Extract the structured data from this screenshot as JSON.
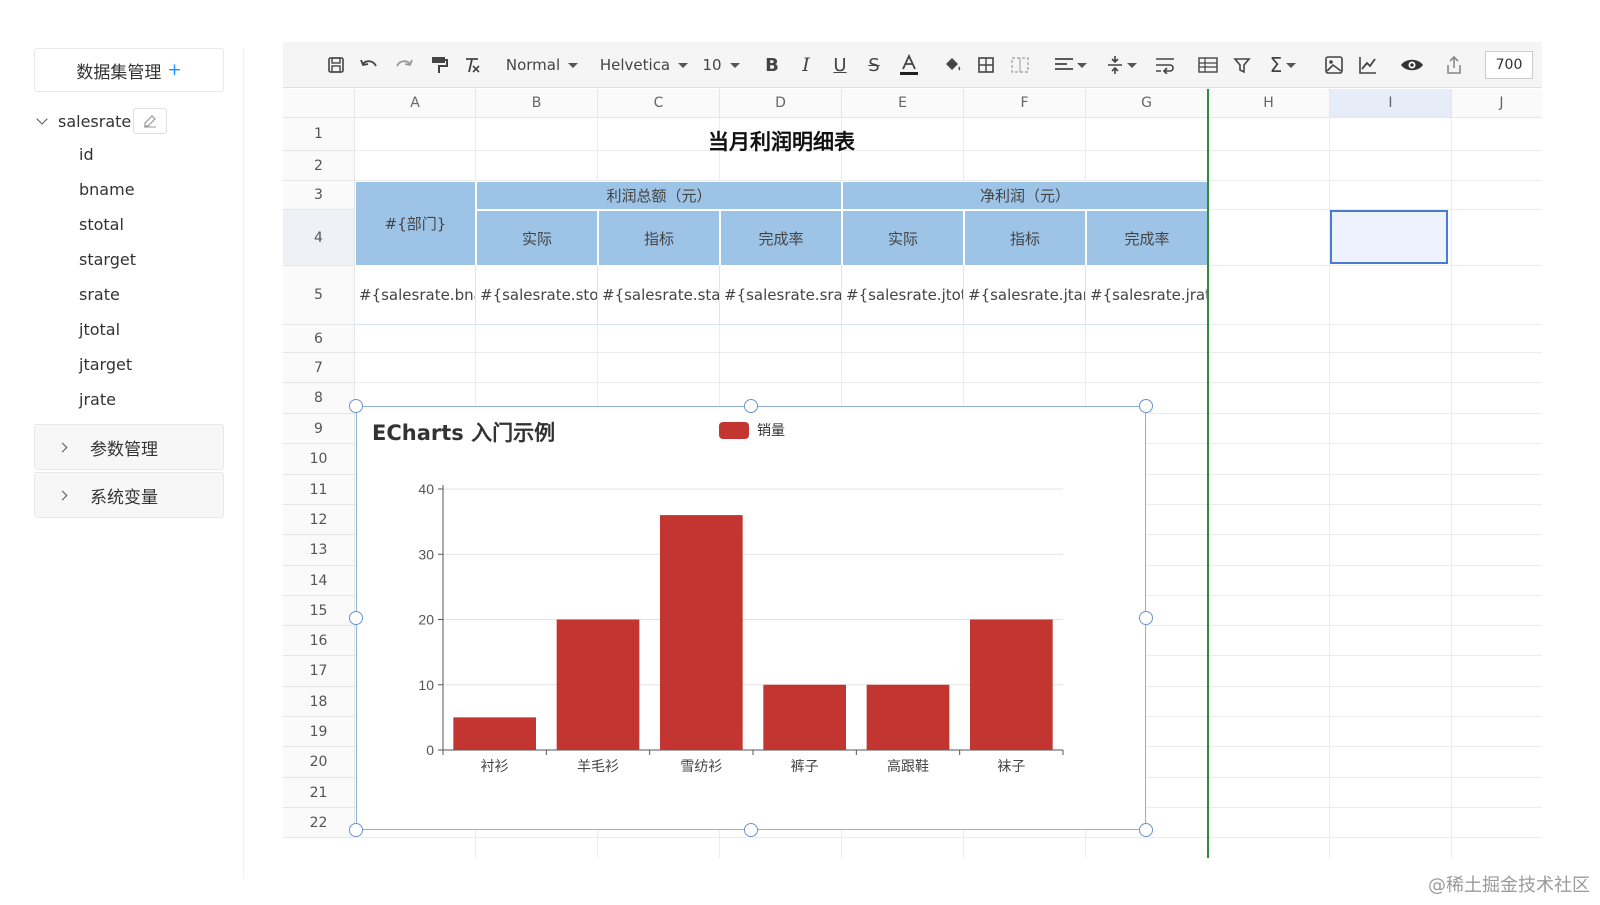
{
  "sidebar": {
    "dataset_title": "数据集管理",
    "dataset_add": "+",
    "tree_root": "salesrate",
    "fields": [
      "id",
      "bname",
      "stotal",
      "starget",
      "srate",
      "jtotal",
      "jtarget",
      "jrate"
    ],
    "panels": [
      "参数管理",
      "系统变量"
    ]
  },
  "toolbar": {
    "style_select": "Normal",
    "font_select": "Helvetica",
    "size_select": "10",
    "zoom_value": "700",
    "icons": [
      "save-icon",
      "undo-icon",
      "redo-icon",
      "paint-format-icon",
      "clear-format-icon",
      "bold-icon",
      "italic-icon",
      "underline-icon",
      "strikethrough-icon",
      "font-color-icon",
      "fill-color-icon",
      "border-icon",
      "merge-icon",
      "align-icon",
      "valign-icon",
      "wrap-icon",
      "freeze-icon",
      "filter-icon",
      "sum-icon",
      "image-icon",
      "chart-icon",
      "preview-icon",
      "export-icon"
    ]
  },
  "sheet": {
    "columns": [
      "A",
      "B",
      "C",
      "D",
      "E",
      "F",
      "G",
      "H",
      "I",
      "J"
    ],
    "rows": [
      "1",
      "2",
      "3",
      "4",
      "5",
      "6",
      "7",
      "8",
      "9",
      "10",
      "11",
      "12",
      "13",
      "14",
      "15",
      "16",
      "17",
      "18",
      "19",
      "20",
      "21",
      "22"
    ],
    "title": "当月利润明细表",
    "dept_header": "#{部门}",
    "profit_total_header": "利润总额（元）",
    "net_profit_header": "净利润（元）",
    "sub_headers": [
      "实际",
      "指标",
      "完成率",
      "实际",
      "指标",
      "完成率"
    ],
    "data_row": [
      "#{salesrate.bname}",
      "#{salesrate.stotal}",
      "#{salesrate.starget}",
      "#{salesrate.srate}",
      "#{salesrate.jtotal}",
      "#{salesrate.jtarget}",
      "#{salesrate.jrate}"
    ],
    "header_fill": "#9dc3e6",
    "freeze_line_color": "#2e8b3a"
  },
  "chart_data": {
    "type": "bar",
    "title": "ECharts 入门示例",
    "categories": [
      "衬衫",
      "羊毛衫",
      "雪纺衫",
      "裤子",
      "高跟鞋",
      "袜子"
    ],
    "series": [
      {
        "name": "销量",
        "values": [
          5,
          20,
          36,
          10,
          10,
          20
        ],
        "color": "#c23531"
      }
    ],
    "ylim": [
      0,
      40
    ],
    "yticks": [
      0,
      10,
      20,
      30,
      40
    ],
    "grid": true,
    "legend_position": "top-center"
  },
  "watermark": "@稀土掘金技术社区"
}
